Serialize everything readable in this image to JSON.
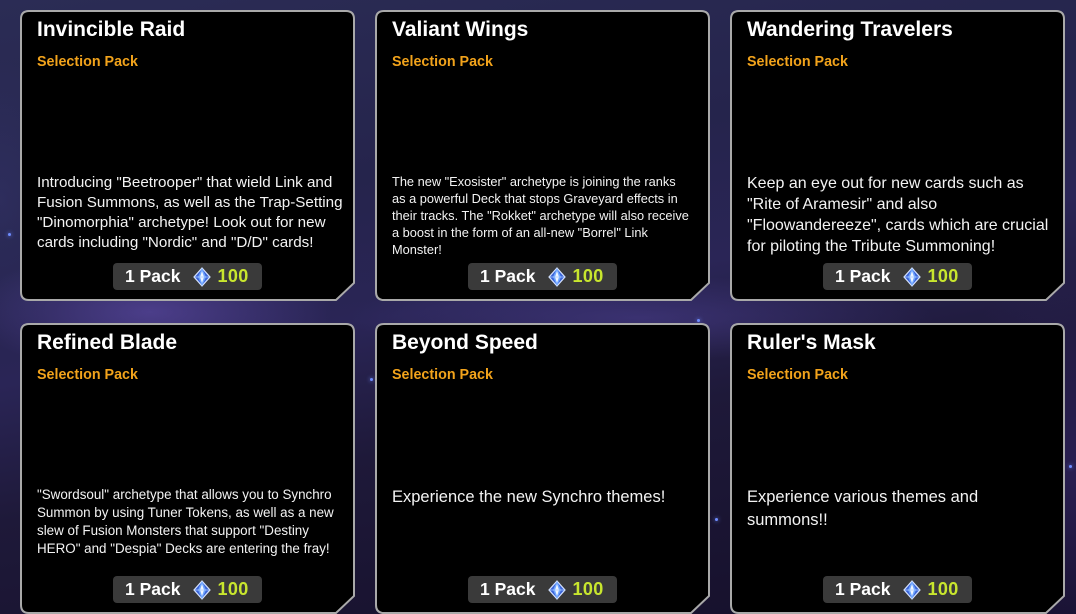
{
  "packs": [
    {
      "title": "Invincible Raid",
      "type": "Selection Pack",
      "description": "Introducing \"Beetrooper\" that wield Link and\nFusion Summons, as well as the Trap-Setting\n\"Dinomorphia\" archetype! Look out for new\ncards including \"Nordic\" and \"D/D\" cards!",
      "quantity_label": "1 Pack",
      "price": "100"
    },
    {
      "title": "Valiant Wings",
      "type": "Selection Pack",
      "description": "The new \"Exosister\" archetype is joining the ranks\nas a powerful Deck that stops Graveyard effects in\ntheir tracks. The \"Rokket\" archetype will also receive\na boost in the form of an all-new \"Borrel\" Link\nMonster!",
      "quantity_label": "1 Pack",
      "price": "100"
    },
    {
      "title": "Wandering Travelers",
      "type": "Selection Pack",
      "description": "Keep an eye out for new cards such as\n\"Rite of Aramesir\" and also\n\"Floowandereeze\", cards which are crucial\nfor piloting the Tribute Summoning!",
      "quantity_label": "1 Pack",
      "price": "100"
    },
    {
      "title": "Refined Blade",
      "type": "Selection Pack",
      "description": "\"Swordsoul\" archetype that allows you to Synchro\nSummon by using Tuner Tokens, as well as a new\nslew of Fusion Monsters that support \"Destiny\nHERO\" and \"Despia\" Decks are entering the fray!",
      "quantity_label": "1 Pack",
      "price": "100"
    },
    {
      "title": "Beyond Speed",
      "type": "Selection Pack",
      "description": "Experience the new Synchro themes!",
      "quantity_label": "1 Pack",
      "price": "100"
    },
    {
      "title": "Ruler's Mask",
      "type": "Selection Pack",
      "description": "Experience various themes and\nsummons!!",
      "quantity_label": "1 Pack",
      "price": "100"
    }
  ],
  "currency_icon": "gem-icon",
  "colors": {
    "pack_type": "#f2a31b",
    "price": "#c8e62e",
    "card_border": "#a9a9a9",
    "card_background": "#000000",
    "button_background": "#3a3a3a"
  }
}
